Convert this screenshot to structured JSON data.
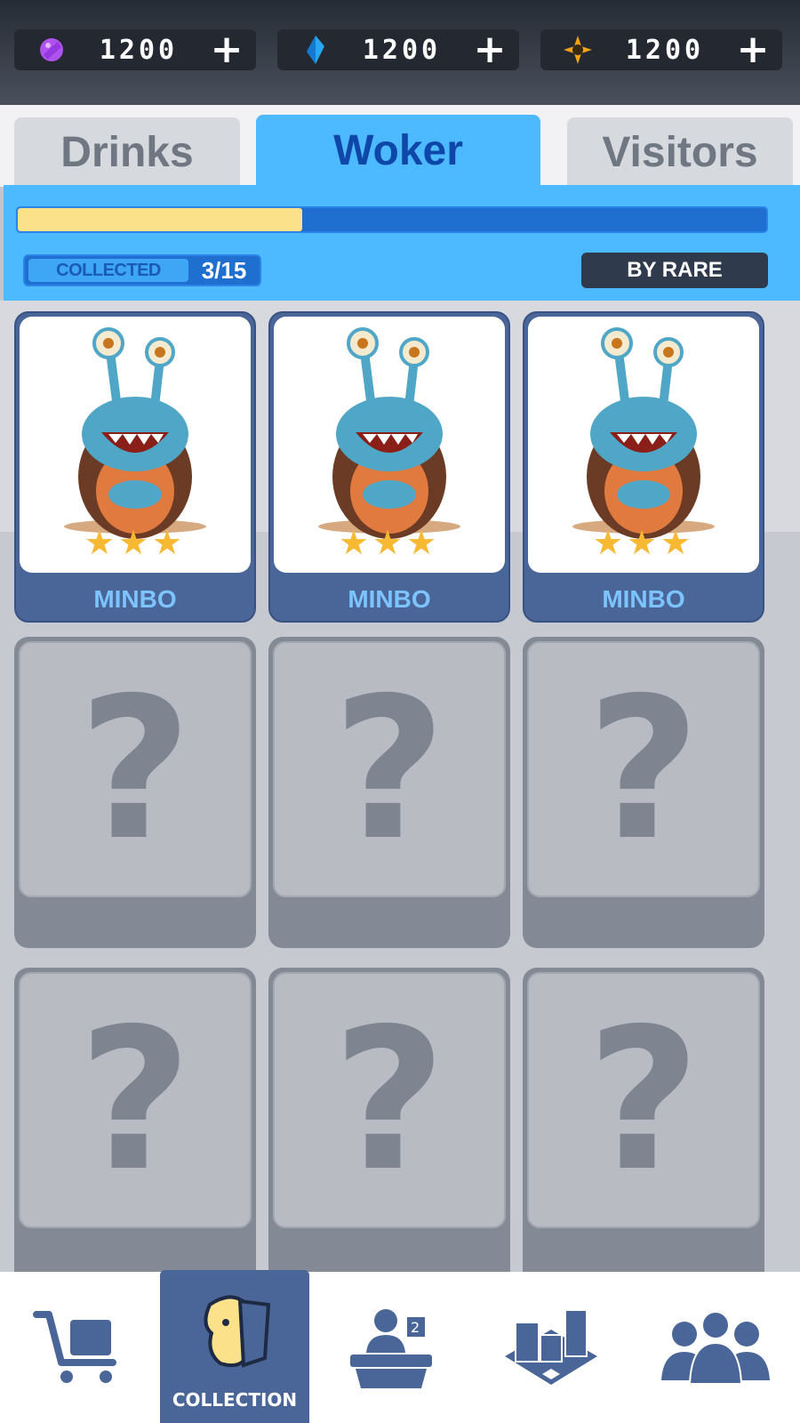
{
  "currencies": [
    {
      "icon": "purple-gem-icon",
      "amount": "1200",
      "plus": "+"
    },
    {
      "icon": "blue-crystal-icon",
      "amount": "1200",
      "plus": "+"
    },
    {
      "icon": "orange-star-token-icon",
      "amount": "1200",
      "plus": "+"
    }
  ],
  "tabs": [
    {
      "label": "Drinks",
      "active": false
    },
    {
      "label": "Woker",
      "active": true
    },
    {
      "label": "Visitors",
      "active": false
    }
  ],
  "progress": {
    "fraction": 0.38
  },
  "collected": {
    "label": "COLLECTED",
    "value": "3/15"
  },
  "sort_button": {
    "label": "BY RARE"
  },
  "cards": [
    {
      "state": "unlocked",
      "name": "MINBO",
      "stars": "★★★"
    },
    {
      "state": "unlocked",
      "name": "MINBO",
      "stars": "★★★"
    },
    {
      "state": "unlocked",
      "name": "MINBO",
      "stars": "★★★"
    },
    {
      "state": "locked",
      "symbol": "?"
    },
    {
      "state": "locked",
      "symbol": "?"
    },
    {
      "state": "locked",
      "symbol": "?"
    },
    {
      "state": "locked",
      "symbol": "?"
    },
    {
      "state": "locked",
      "symbol": "?"
    },
    {
      "state": "locked",
      "symbol": "?"
    }
  ],
  "bottom_nav": [
    {
      "icon": "shopping-cart-icon",
      "label": ""
    },
    {
      "icon": "collection-icon",
      "label": "COLLECTION",
      "active": true
    },
    {
      "icon": "reception-desk-icon",
      "label": ""
    },
    {
      "icon": "building-icon",
      "label": ""
    },
    {
      "icon": "people-group-icon",
      "label": ""
    }
  ],
  "colors": {
    "accent": "#4db9ff",
    "active_tab_text": "#0f47a8",
    "card_blue": "#4a6597",
    "progress_fill": "#fbe28a",
    "star": "#f8b932"
  }
}
